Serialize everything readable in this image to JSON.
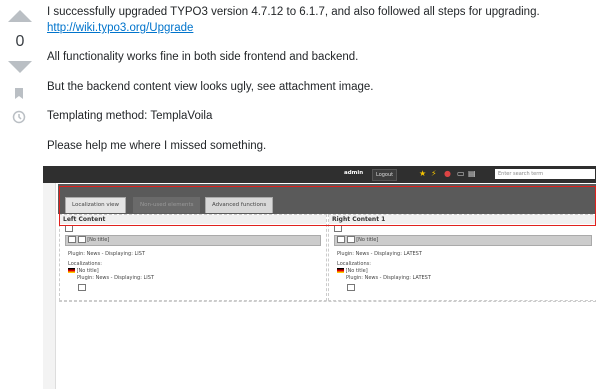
{
  "vote": {
    "score": "0"
  },
  "post": {
    "line1": "I successfully upgraded TYPO3 version 4.7.12 to 6.1.7, and also followed all steps for upgrading.",
    "link": "http://wiki.typo3.org/Upgrade",
    "line2": "All functionality works fine in both side frontend and backend.",
    "line3": "But the backend content view looks ugly, see attachment image.",
    "line4": "Templating method: TemplaVoila",
    "line5": "Please help me where I missed something."
  },
  "screenshot": {
    "user": "admin",
    "logout": "Logout",
    "search_placeholder": "Enter search term",
    "tabs": [
      "Localization view",
      "Non-used elements",
      "Advanced functions"
    ],
    "left": {
      "header": "Left Content",
      "title": "[No title]",
      "plugin": "Plugin: News - Displaying: LIST",
      "localizations": "Localizations:",
      "loc_title": "[No title]",
      "loc_plugin": "Plugin: News - Displaying: LIST"
    },
    "right": {
      "header": "Right Content 1",
      "title": "[No title]",
      "plugin": "Plugin: News - Displaying: LATEST",
      "localizations": "Localizations:",
      "loc_title": "[No title]",
      "loc_plugin": "Plugin: News - Displaying: LATEST"
    }
  }
}
